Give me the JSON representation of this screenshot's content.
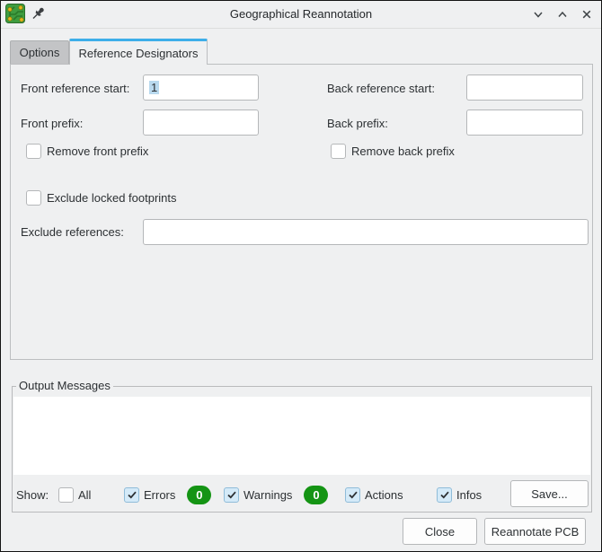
{
  "window": {
    "title": "Geographical Reannotation"
  },
  "tabs": [
    {
      "label": "Options",
      "active": false
    },
    {
      "label": "Reference Designators",
      "active": true
    }
  ],
  "form": {
    "front_reference_start": {
      "label": "Front reference start:",
      "value": "1"
    },
    "back_reference_start": {
      "label": "Back reference start:",
      "value": ""
    },
    "front_prefix": {
      "label": "Front prefix:",
      "value": ""
    },
    "back_prefix": {
      "label": "Back prefix:",
      "value": ""
    },
    "remove_front_prefix": {
      "label": "Remove front prefix",
      "checked": false
    },
    "remove_back_prefix": {
      "label": "Remove back prefix",
      "checked": false
    },
    "exclude_locked_footprints": {
      "label": "Exclude locked footprints",
      "checked": false
    },
    "exclude_references": {
      "label": "Exclude references:",
      "value": ""
    }
  },
  "output": {
    "group_label": "Output Messages",
    "messages_text": "",
    "show_label": "Show:",
    "filters": [
      {
        "label": "All",
        "checked": false
      },
      {
        "label": "Errors",
        "checked": true,
        "count": "0"
      },
      {
        "label": "Warnings",
        "checked": true,
        "count": "0"
      },
      {
        "label": "Actions",
        "checked": true
      },
      {
        "label": "Infos",
        "checked": true
      }
    ],
    "save_label": "Save..."
  },
  "buttons": {
    "close": "Close",
    "reannotate": "Reannotate PCB"
  },
  "colors": {
    "accent": "#3daee9",
    "badge_green": "#149414",
    "selection": "#b9d9ee"
  }
}
